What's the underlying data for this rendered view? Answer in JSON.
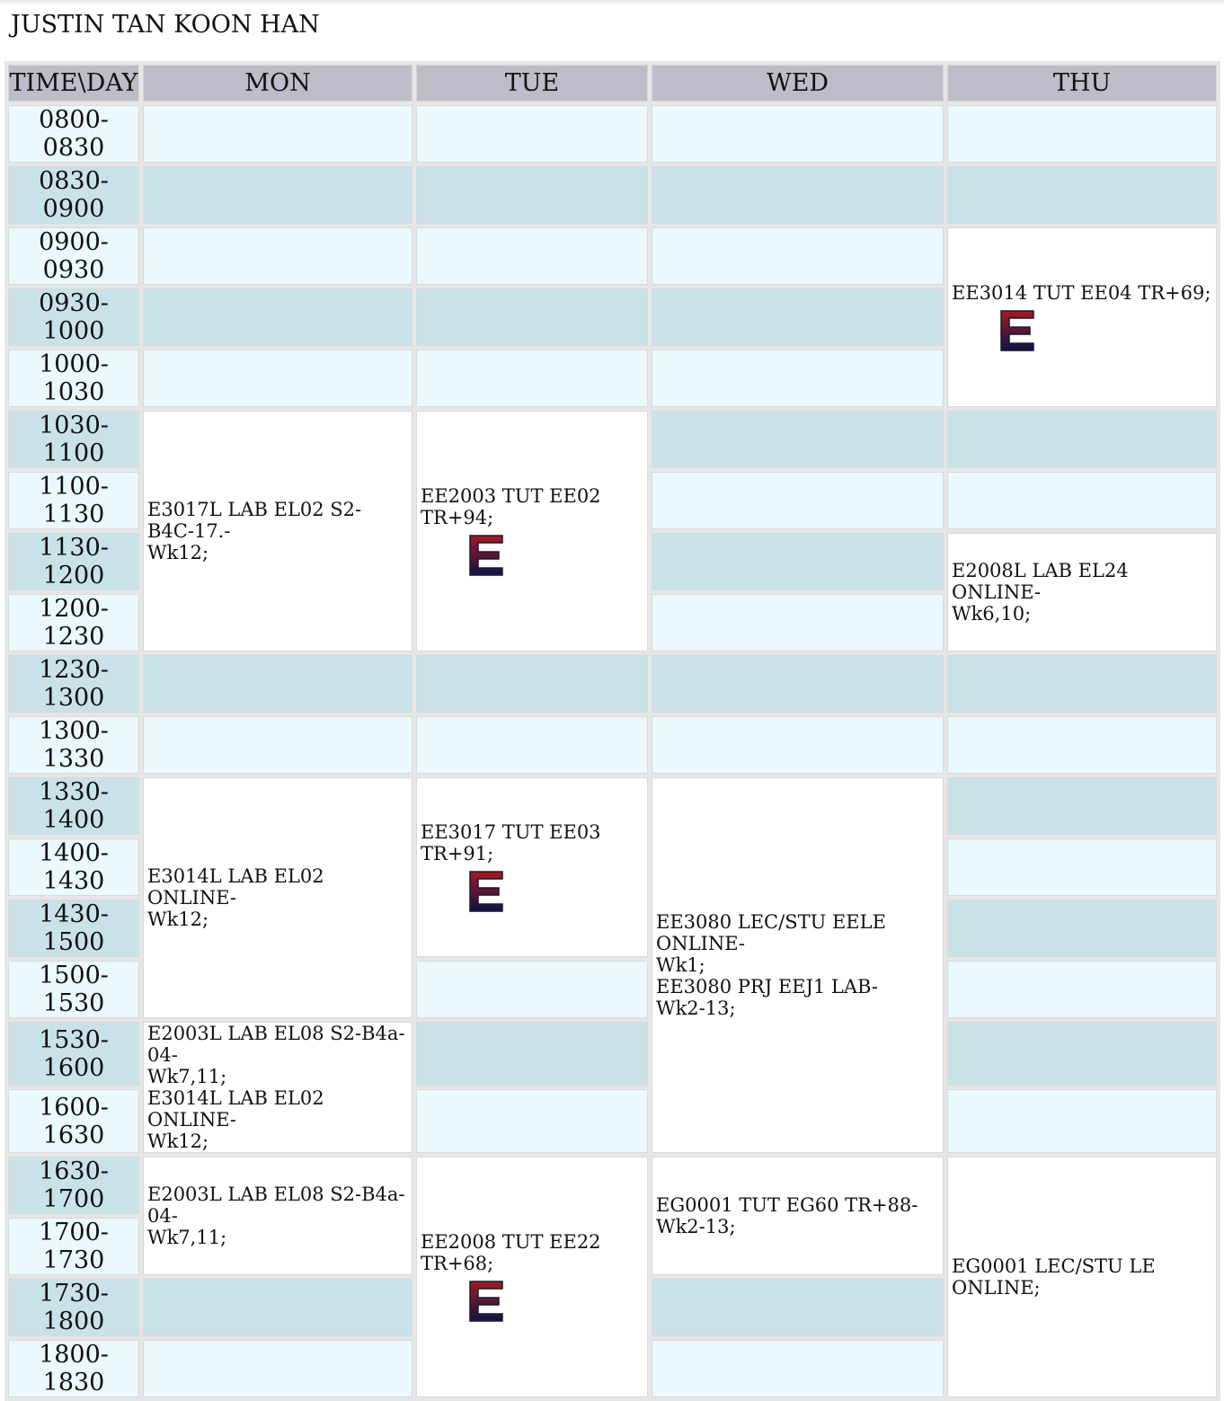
{
  "student_name": "JUSTIN TAN KOON HAN",
  "columns": [
    "TIME\\DAY",
    "MON",
    "TUE",
    "WED",
    "THU"
  ],
  "rows": [
    {
      "time": "0800-0830",
      "cells": [
        {
          "type": "empty"
        },
        {
          "type": "empty"
        },
        {
          "type": "empty"
        },
        {
          "type": "empty"
        }
      ]
    },
    {
      "time": "0830-0900",
      "cells": [
        {
          "type": "empty"
        },
        {
          "type": "empty"
        },
        {
          "type": "empty"
        },
        {
          "type": "empty"
        }
      ]
    },
    {
      "time": "0900-0930",
      "cells": [
        {
          "type": "empty"
        },
        {
          "type": "empty"
        },
        {
          "type": "empty"
        },
        {
          "type": "event",
          "rowspan": 3,
          "lines": [
            "EE3014 TUT EE04 TR+69;"
          ],
          "icon": true
        }
      ]
    },
    {
      "time": "0930-1000",
      "cells": [
        {
          "type": "empty"
        },
        {
          "type": "empty"
        },
        {
          "type": "empty"
        }
      ]
    },
    {
      "time": "1000-1030",
      "cells": [
        {
          "type": "empty"
        },
        {
          "type": "empty"
        },
        {
          "type": "empty"
        }
      ]
    },
    {
      "time": "1030-1100",
      "cells": [
        {
          "type": "event",
          "rowspan": 4,
          "lines": [
            "E3017L LAB EL02 S2-B4C-17.-",
            "Wk12;"
          ]
        },
        {
          "type": "event",
          "rowspan": 4,
          "lines": [
            "EE2003 TUT EE02 TR+94;"
          ],
          "icon": true
        },
        {
          "type": "empty"
        },
        {
          "type": "empty"
        }
      ]
    },
    {
      "time": "1100-1130",
      "cells": [
        {
          "type": "empty"
        },
        {
          "type": "empty"
        }
      ]
    },
    {
      "time": "1130-1200",
      "cells": [
        {
          "type": "empty"
        },
        {
          "type": "event",
          "rowspan": 2,
          "lines": [
            "E2008L LAB EL24 ONLINE-",
            "Wk6,10;"
          ]
        }
      ]
    },
    {
      "time": "1200-1230",
      "cells": [
        {
          "type": "empty"
        }
      ]
    },
    {
      "time": "1230-1300",
      "cells": [
        {
          "type": "empty"
        },
        {
          "type": "empty"
        },
        {
          "type": "empty"
        },
        {
          "type": "empty"
        }
      ]
    },
    {
      "time": "1300-1330",
      "cells": [
        {
          "type": "empty"
        },
        {
          "type": "empty"
        },
        {
          "type": "empty"
        },
        {
          "type": "empty"
        }
      ]
    },
    {
      "time": "1330-1400",
      "cells": [
        {
          "type": "event",
          "rowspan": 4,
          "lines": [
            "E3014L LAB EL02 ONLINE-",
            "Wk12;"
          ]
        },
        {
          "type": "event",
          "rowspan": 3,
          "lines": [
            "EE3017 TUT EE03 TR+91;"
          ],
          "icon": true
        },
        {
          "type": "event",
          "rowspan": 6,
          "lines": [
            "EE3080 LEC/STU EELE ONLINE-",
            "Wk1;",
            "EE3080 PRJ EEJ1 LAB-",
            "Wk2-13;"
          ]
        },
        {
          "type": "empty"
        }
      ]
    },
    {
      "time": "1400-1430",
      "cells": [
        {
          "type": "empty"
        }
      ]
    },
    {
      "time": "1430-1500",
      "cells": [
        {
          "type": "empty"
        }
      ]
    },
    {
      "time": "1500-1530",
      "cells": [
        {
          "type": "empty"
        },
        {
          "type": "empty"
        }
      ]
    },
    {
      "time": "1530-1600",
      "cells": [
        {
          "type": "event",
          "rowspan": 2,
          "lines": [
            "E2003L LAB EL08 S2-B4a-04-",
            "Wk7,11;",
            "E3014L LAB EL02 ONLINE-",
            "Wk12;"
          ]
        },
        {
          "type": "empty"
        },
        {
          "type": "empty"
        }
      ]
    },
    {
      "time": "1600-1630",
      "cells": [
        {
          "type": "empty"
        },
        {
          "type": "empty"
        }
      ]
    },
    {
      "time": "1630-1700",
      "cells": [
        {
          "type": "event",
          "rowspan": 2,
          "lines": [
            "E2003L LAB EL08 S2-B4a-04-",
            "Wk7,11;"
          ]
        },
        {
          "type": "event",
          "rowspan": 4,
          "lines": [
            "EE2008 TUT EE22 TR+68;"
          ],
          "icon": true
        },
        {
          "type": "event",
          "rowspan": 2,
          "lines": [
            "EG0001 TUT EG60 TR+88-",
            "Wk2-13;"
          ]
        },
        {
          "type": "event",
          "rowspan": 4,
          "lines": [
            "EG0001 LEC/STU LE ONLINE;"
          ]
        }
      ]
    },
    {
      "time": "1700-1730",
      "cells": []
    },
    {
      "time": "1730-1800",
      "cells": [
        {
          "type": "empty"
        },
        {
          "type": "empty"
        }
      ]
    },
    {
      "time": "1800-1830",
      "cells": [
        {
          "type": "empty"
        },
        {
          "type": "empty"
        }
      ]
    }
  ],
  "icon_gradient": {
    "top": "#a31a24",
    "bottom": "#0f1246"
  }
}
